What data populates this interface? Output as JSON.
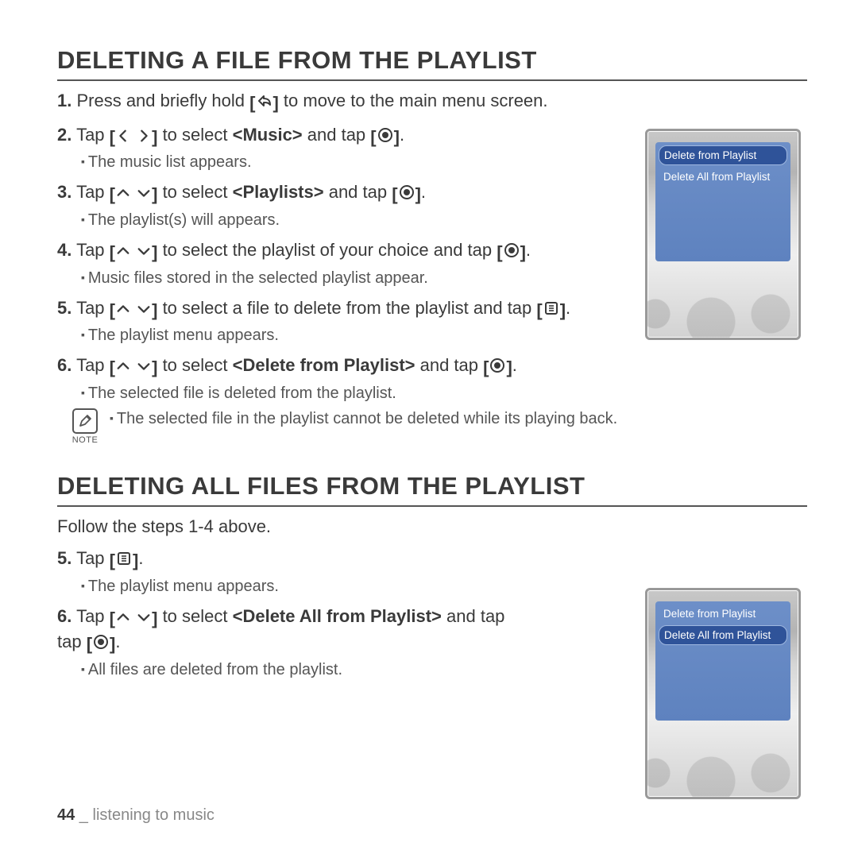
{
  "section1": {
    "title": "DELETING A FILE FROM THE PLAYLIST",
    "step1_a": "1.",
    "step1_b": " Press and briefly hold ",
    "step1_c": " to move to the main menu screen.",
    "step2_a": "2.",
    "step2_b": " Tap ",
    "step2_c": " to select ",
    "step2_d": "<Music>",
    "step2_e": " and tap ",
    "step2_end": ".",
    "sub2": "The music list appears.",
    "step3_a": "3.",
    "step3_b": " Tap ",
    "step3_c": " to select ",
    "step3_d": "<Playlists>",
    "step3_e": " and tap ",
    "step3_end": ".",
    "sub3": "The playlist(s) will appears.",
    "step4_a": "4.",
    "step4_b": " Tap ",
    "step4_c": " to select the playlist of your choice and tap ",
    "step4_end": ".",
    "sub4": "Music files stored in the selected playlist appear.",
    "step5_a": "5.",
    "step5_b": " Tap ",
    "step5_c": " to select a file to delete from the playlist and tap ",
    "step5_end": ".",
    "sub5": "The playlist menu appears.",
    "step6_a": "6.",
    "step6_b": " Tap ",
    "step6_c": " to select ",
    "step6_d": "<Delete from Playlist>",
    "step6_e": " and tap ",
    "step6_end": ".",
    "sub6": "The selected file is deleted from the playlist.",
    "note": "The selected file in the playlist cannot be deleted while its playing back.",
    "note_label": "NOTE"
  },
  "section2": {
    "title": "DELETING ALL FILES FROM THE PLAYLIST",
    "intro": "Follow the steps 1-4 above.",
    "step5_a": "5.",
    "step5_b": " Tap ",
    "step5_end": ".",
    "sub5": "The playlist menu appears.",
    "step6_a": "6.",
    "step6_b": " Tap ",
    "step6_c": " to select ",
    "step6_d": "<Delete All from Playlist>",
    "step6_e": " and tap ",
    "step6_end": ".",
    "sub6": "All files are deleted from the playlist."
  },
  "device_menu": {
    "item1": "Delete from Playlist",
    "item2": "Delete All from Playlist"
  },
  "footer": {
    "page": "44",
    "sep": " _ ",
    "chapter": "listening to music"
  },
  "icons": {
    "back": "back-icon",
    "left": "left-icon",
    "right": "right-icon",
    "up": "up-icon",
    "down": "down-icon",
    "select": "select-icon",
    "menu": "menu-icon"
  }
}
